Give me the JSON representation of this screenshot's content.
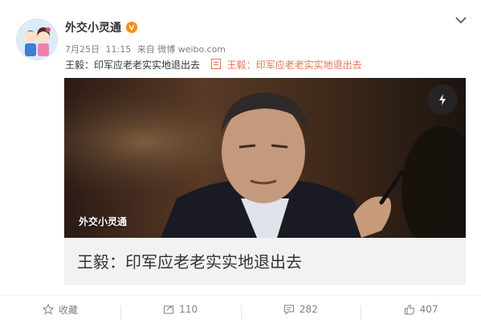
{
  "post": {
    "username": "外交小灵通",
    "date": "7月25日",
    "time": "11:15",
    "source": "来自 微博 weibo.com",
    "text": "王毅：印军应老老实实地退出去",
    "link_text": "王毅：印军应老老实实地退出去"
  },
  "media": {
    "watermark": "外交小灵通",
    "title": "王毅：印军应老老实实地退出去"
  },
  "actions": {
    "favorite_label": "收藏",
    "repost_count": "110",
    "comment_count": "282",
    "like_count": "407"
  },
  "colors": {
    "link": "#eb7350",
    "verified": "#ff8a00",
    "meta": "#808080"
  },
  "icons": [
    "avatar-cartoon",
    "verified-v-icon",
    "chevron-down-icon",
    "document-icon",
    "lightning-icon",
    "star-icon",
    "repost-icon",
    "comment-icon",
    "thumbs-up-icon"
  ]
}
